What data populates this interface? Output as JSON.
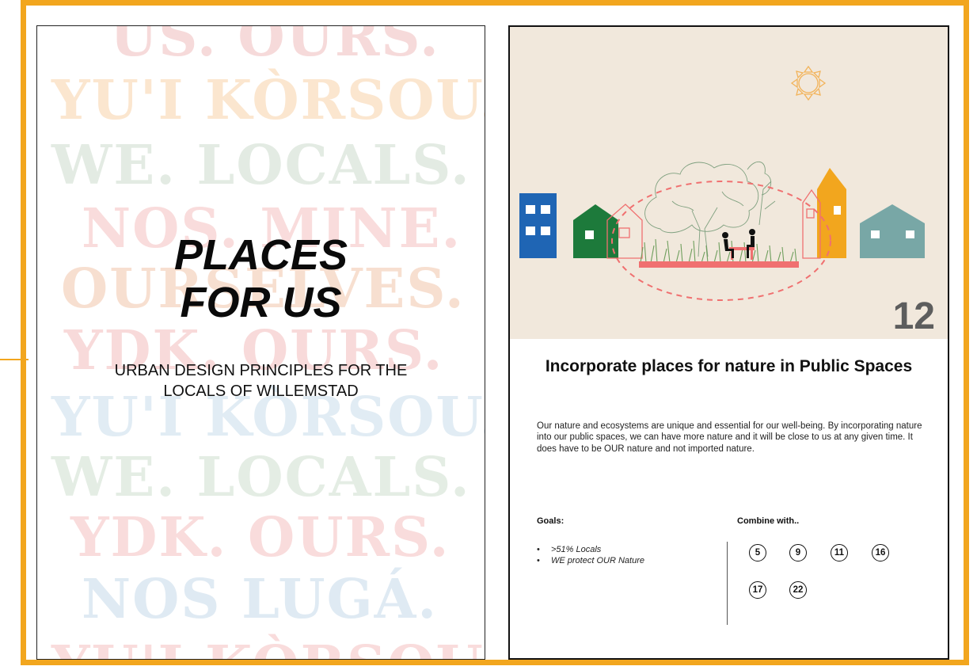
{
  "cover": {
    "background_words": [
      {
        "text": "US. OURS.",
        "color": "#f6dada"
      },
      {
        "text": "YU'I KÒRSOU.",
        "color": "#fbe6cf"
      },
      {
        "text": "WE. LOCALS.",
        "color": "#e3ebe3"
      },
      {
        "text": "NOS. MINE.",
        "color": "#f9dcdc"
      },
      {
        "text": "OURSELVES.",
        "color": "#f7dfd0"
      },
      {
        "text": "YDK. OURS.",
        "color": "#f8dada"
      },
      {
        "text": "YU'I KÒRSOU.",
        "color": "#e1ecf4"
      },
      {
        "text": "WE. LOCALS.",
        "color": "#e4ede4"
      },
      {
        "text": "YDK. OURS.",
        "color": "#f9dcdc"
      },
      {
        "text": "NOS LUGÁ.",
        "color": "#dfeaf3"
      },
      {
        "text": "YU'I KÒRSOU.",
        "color": "#f9dcdc"
      }
    ],
    "title_line1": "PLACES",
    "title_line2": "FOR US",
    "subtitle_line1": "URBAN DESIGN PRINCIPLES FOR THE",
    "subtitle_line2": "LOCALS OF WILLEMSTAD"
  },
  "principle": {
    "number": "12",
    "title": "Incorporate places for nature in Public Spaces",
    "body": "Our nature and ecosystems are unique and essential for our well-being. By incorporating nature into our public spaces, we can have more nature and it will be close to us at any given time. It does have to be OUR nature and not imported nature.",
    "goals_heading": "Goals:",
    "goals": [
      ">51% Locals",
      "WE protect OUR Nature"
    ],
    "combine_heading": "Combine with..",
    "combine": [
      "5",
      "9",
      "11",
      "16",
      "17",
      "22"
    ]
  },
  "colors": {
    "frame": "#f2a61e",
    "illustration_bg": "#f1e8dc",
    "house_blue": "#1f65b4",
    "house_green": "#1d7a3b",
    "house_orange": "#f2a61e",
    "house_teal": "#78a7a6",
    "accent_red": "#f07070"
  },
  "icons": [
    "sun-icon",
    "tree-icon",
    "people-bench-icon"
  ]
}
